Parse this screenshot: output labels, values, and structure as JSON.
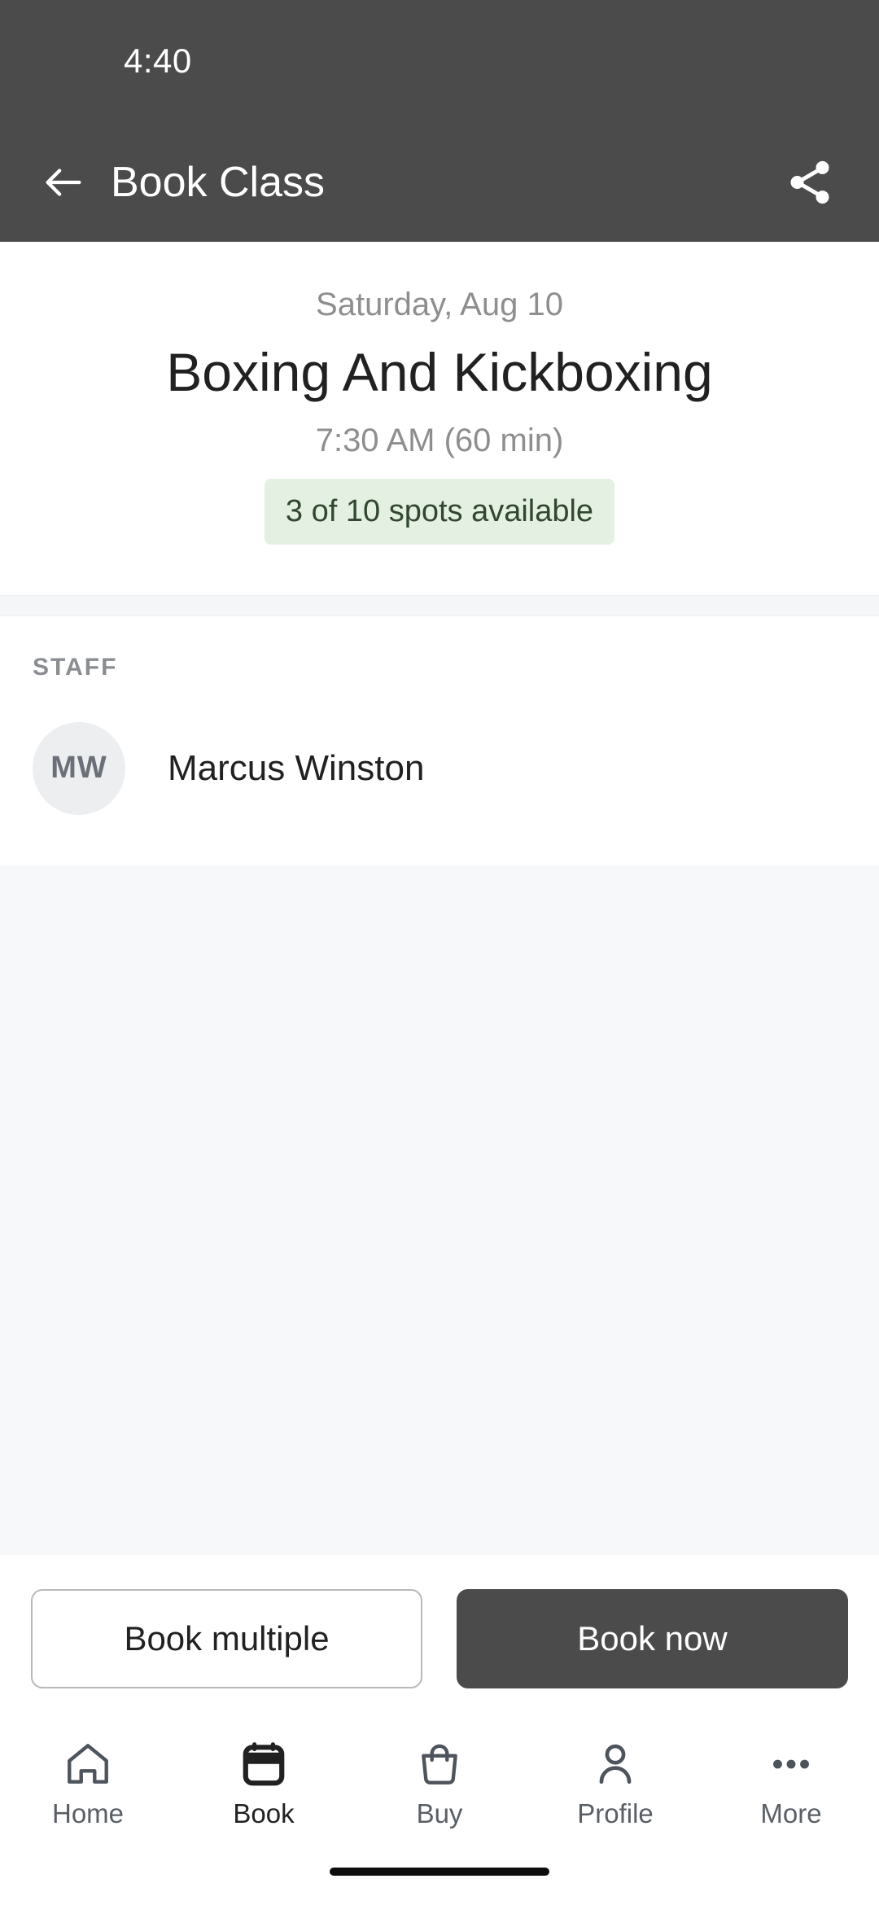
{
  "status_bar": {
    "time": "4:40",
    "background": "#4b4b4b"
  },
  "app_bar": {
    "title": "Book Class",
    "back_icon": "arrow-left-icon",
    "share_icon": "share-icon",
    "background": "#4b4b4b"
  },
  "class_details": {
    "date": "Saturday, Aug 10",
    "title": "Boxing And Kickboxing",
    "time": "7:30 AM (60 min)",
    "availability": "3 of 10 spots available",
    "availability_bg": "#e4f0e2",
    "availability_color": "#31482f"
  },
  "staff_section": {
    "label": "STAFF",
    "members": [
      {
        "initials": "MW",
        "name": "Marcus Winston"
      }
    ]
  },
  "actions": {
    "secondary_label": "Book multiple",
    "primary_label": "Book now",
    "primary_bg": "#4b4b4b"
  },
  "bottom_nav": {
    "active_index": 1,
    "items": [
      {
        "label": "Home",
        "icon": "home-icon"
      },
      {
        "label": "Book",
        "icon": "calendar-icon"
      },
      {
        "label": "Buy",
        "icon": "shopping-bag-icon"
      },
      {
        "label": "Profile",
        "icon": "person-icon"
      },
      {
        "label": "More",
        "icon": "more-horizontal-icon"
      }
    ]
  }
}
